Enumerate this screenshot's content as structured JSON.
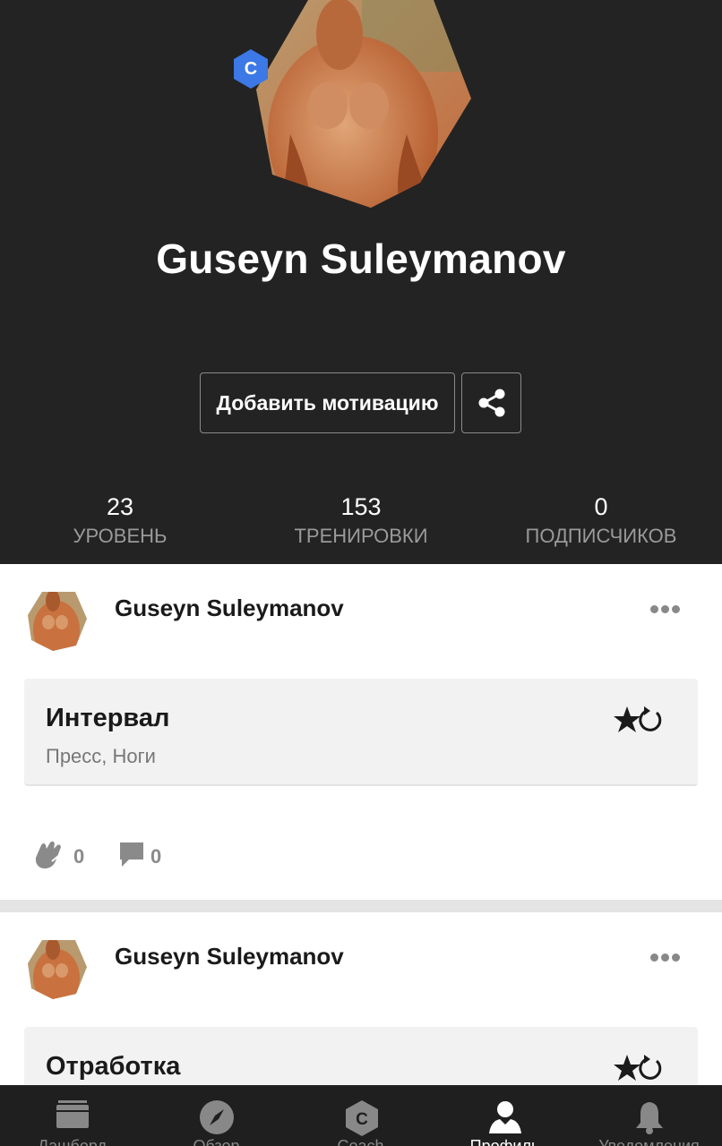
{
  "profile": {
    "name": "Guseyn Suleymanov",
    "level_badge": "C",
    "motivation_button": "Добавить мотивацию"
  },
  "stats": [
    {
      "value": "23",
      "label": "УРОВЕНЬ"
    },
    {
      "value": "153",
      "label": "ТРЕНИРОВКИ"
    },
    {
      "value": "0",
      "label": "ПОДПИСЧИКОВ"
    }
  ],
  "feed": [
    {
      "author": "Guseyn Suleymanov",
      "workout_title": "Интервал",
      "workout_tags": "Пресс, Ноги",
      "claps": "0",
      "comments": "0"
    },
    {
      "author": "Guseyn Suleymanov",
      "workout_title": "Отработка"
    }
  ],
  "bottom_nav": {
    "badge": "C",
    "items": [
      {
        "icon": "dashboard-icon",
        "label": "Дашборд"
      },
      {
        "icon": "compass-icon",
        "label": "Обзор"
      },
      {
        "icon": "coach-hex-icon",
        "label": "Coach"
      },
      {
        "icon": "profile-icon",
        "label": "Профиль",
        "active": true
      },
      {
        "icon": "bell-icon",
        "label": "Уведомления"
      }
    ]
  },
  "colors": {
    "header_bg": "#232323",
    "badge_blue": "#3c78e6",
    "card_bg": "#f2f2f2",
    "nav_bg": "#1f1f1f"
  }
}
